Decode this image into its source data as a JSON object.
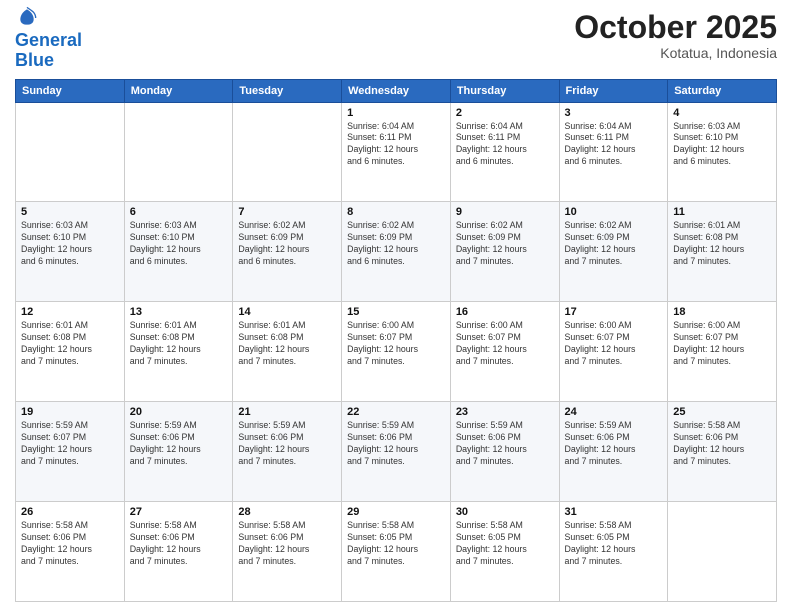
{
  "logo": {
    "line1": "General",
    "line2": "Blue"
  },
  "header": {
    "month": "October 2025",
    "location": "Kotatua, Indonesia"
  },
  "weekdays": [
    "Sunday",
    "Monday",
    "Tuesday",
    "Wednesday",
    "Thursday",
    "Friday",
    "Saturday"
  ],
  "weeks": [
    [
      {
        "day": "",
        "info": ""
      },
      {
        "day": "",
        "info": ""
      },
      {
        "day": "",
        "info": ""
      },
      {
        "day": "1",
        "info": "Sunrise: 6:04 AM\nSunset: 6:11 PM\nDaylight: 12 hours\nand 6 minutes."
      },
      {
        "day": "2",
        "info": "Sunrise: 6:04 AM\nSunset: 6:11 PM\nDaylight: 12 hours\nand 6 minutes."
      },
      {
        "day": "3",
        "info": "Sunrise: 6:04 AM\nSunset: 6:11 PM\nDaylight: 12 hours\nand 6 minutes."
      },
      {
        "day": "4",
        "info": "Sunrise: 6:03 AM\nSunset: 6:10 PM\nDaylight: 12 hours\nand 6 minutes."
      }
    ],
    [
      {
        "day": "5",
        "info": "Sunrise: 6:03 AM\nSunset: 6:10 PM\nDaylight: 12 hours\nand 6 minutes."
      },
      {
        "day": "6",
        "info": "Sunrise: 6:03 AM\nSunset: 6:10 PM\nDaylight: 12 hours\nand 6 minutes."
      },
      {
        "day": "7",
        "info": "Sunrise: 6:02 AM\nSunset: 6:09 PM\nDaylight: 12 hours\nand 6 minutes."
      },
      {
        "day": "8",
        "info": "Sunrise: 6:02 AM\nSunset: 6:09 PM\nDaylight: 12 hours\nand 6 minutes."
      },
      {
        "day": "9",
        "info": "Sunrise: 6:02 AM\nSunset: 6:09 PM\nDaylight: 12 hours\nand 7 minutes."
      },
      {
        "day": "10",
        "info": "Sunrise: 6:02 AM\nSunset: 6:09 PM\nDaylight: 12 hours\nand 7 minutes."
      },
      {
        "day": "11",
        "info": "Sunrise: 6:01 AM\nSunset: 6:08 PM\nDaylight: 12 hours\nand 7 minutes."
      }
    ],
    [
      {
        "day": "12",
        "info": "Sunrise: 6:01 AM\nSunset: 6:08 PM\nDaylight: 12 hours\nand 7 minutes."
      },
      {
        "day": "13",
        "info": "Sunrise: 6:01 AM\nSunset: 6:08 PM\nDaylight: 12 hours\nand 7 minutes."
      },
      {
        "day": "14",
        "info": "Sunrise: 6:01 AM\nSunset: 6:08 PM\nDaylight: 12 hours\nand 7 minutes."
      },
      {
        "day": "15",
        "info": "Sunrise: 6:00 AM\nSunset: 6:07 PM\nDaylight: 12 hours\nand 7 minutes."
      },
      {
        "day": "16",
        "info": "Sunrise: 6:00 AM\nSunset: 6:07 PM\nDaylight: 12 hours\nand 7 minutes."
      },
      {
        "day": "17",
        "info": "Sunrise: 6:00 AM\nSunset: 6:07 PM\nDaylight: 12 hours\nand 7 minutes."
      },
      {
        "day": "18",
        "info": "Sunrise: 6:00 AM\nSunset: 6:07 PM\nDaylight: 12 hours\nand 7 minutes."
      }
    ],
    [
      {
        "day": "19",
        "info": "Sunrise: 5:59 AM\nSunset: 6:07 PM\nDaylight: 12 hours\nand 7 minutes."
      },
      {
        "day": "20",
        "info": "Sunrise: 5:59 AM\nSunset: 6:06 PM\nDaylight: 12 hours\nand 7 minutes."
      },
      {
        "day": "21",
        "info": "Sunrise: 5:59 AM\nSunset: 6:06 PM\nDaylight: 12 hours\nand 7 minutes."
      },
      {
        "day": "22",
        "info": "Sunrise: 5:59 AM\nSunset: 6:06 PM\nDaylight: 12 hours\nand 7 minutes."
      },
      {
        "day": "23",
        "info": "Sunrise: 5:59 AM\nSunset: 6:06 PM\nDaylight: 12 hours\nand 7 minutes."
      },
      {
        "day": "24",
        "info": "Sunrise: 5:59 AM\nSunset: 6:06 PM\nDaylight: 12 hours\nand 7 minutes."
      },
      {
        "day": "25",
        "info": "Sunrise: 5:58 AM\nSunset: 6:06 PM\nDaylight: 12 hours\nand 7 minutes."
      }
    ],
    [
      {
        "day": "26",
        "info": "Sunrise: 5:58 AM\nSunset: 6:06 PM\nDaylight: 12 hours\nand 7 minutes."
      },
      {
        "day": "27",
        "info": "Sunrise: 5:58 AM\nSunset: 6:06 PM\nDaylight: 12 hours\nand 7 minutes."
      },
      {
        "day": "28",
        "info": "Sunrise: 5:58 AM\nSunset: 6:06 PM\nDaylight: 12 hours\nand 7 minutes."
      },
      {
        "day": "29",
        "info": "Sunrise: 5:58 AM\nSunset: 6:05 PM\nDaylight: 12 hours\nand 7 minutes."
      },
      {
        "day": "30",
        "info": "Sunrise: 5:58 AM\nSunset: 6:05 PM\nDaylight: 12 hours\nand 7 minutes."
      },
      {
        "day": "31",
        "info": "Sunrise: 5:58 AM\nSunset: 6:05 PM\nDaylight: 12 hours\nand 7 minutes."
      },
      {
        "day": "",
        "info": ""
      }
    ]
  ]
}
